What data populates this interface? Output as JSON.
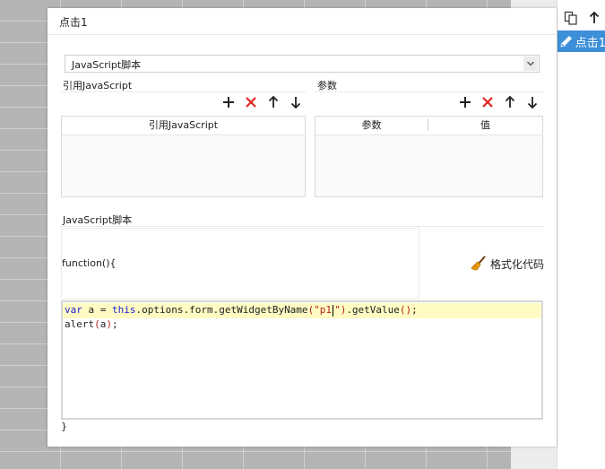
{
  "dialog": {
    "title": "点击1",
    "script_type": {
      "selected": "JavaScript脚本"
    }
  },
  "refs": {
    "section_label": "引用JavaScript",
    "column_header": "引用JavaScript",
    "toolbar": {
      "add": "+",
      "delete": "✕",
      "up": "↑",
      "down": "↓"
    }
  },
  "params": {
    "section_label": "参数",
    "columns": [
      "参数",
      "值"
    ],
    "toolbar": {
      "add": "+",
      "delete": "✕",
      "up": "↑",
      "down": "↓"
    }
  },
  "script": {
    "section_label": "JavaScript脚本",
    "function_open": "function(){",
    "format_button": "格式化代码",
    "function_close": "}",
    "code": {
      "l1_var": "var",
      "l1_a": " a = ",
      "l1_this": "this",
      "l1_mid": ".options.form.getWidgetByName",
      "l1_lp": "(",
      "l1_str1": "\"p1",
      "l1_str2": "\"",
      "l1_rp": ")",
      "l1_get": ".getValue",
      "l1_call": "()",
      "l1_semi": ";",
      "l2_fn": "alert",
      "l2_lp": "(",
      "l2_arg": "a",
      "l2_rp": ")",
      "l2_semi": ";"
    }
  },
  "side_panel": {
    "item_label": "点击1"
  },
  "colors": {
    "accent": "#3d8fd9",
    "delete_red": "#e0261f",
    "highlight_line": "#fffbc2",
    "keyword": "#1d1dd6",
    "string": "#b8211f"
  }
}
